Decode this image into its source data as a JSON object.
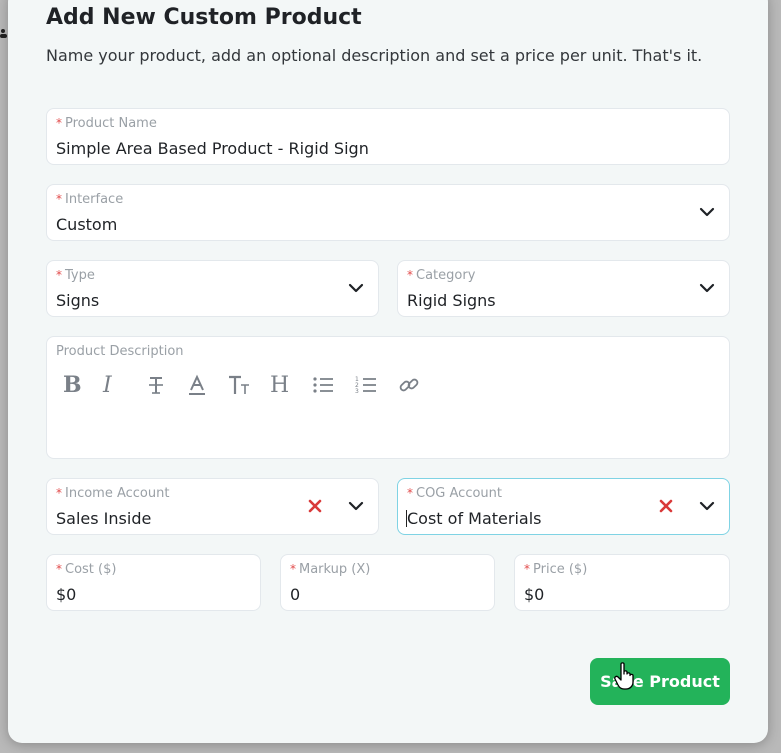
{
  "modal": {
    "title": "Add New Custom Product",
    "subtitle": "Name your product, add an optional description and set a price per unit. That's it."
  },
  "fields": {
    "product_name": {
      "label": "Product Name",
      "value": "Simple Area Based Product - Rigid Sign",
      "required_mark": "*"
    },
    "interface": {
      "label": "Interface",
      "value": "Custom",
      "required_mark": "*"
    },
    "type": {
      "label": "Type",
      "value": "Signs",
      "required_mark": "*"
    },
    "category": {
      "label": "Category",
      "value": "Rigid Signs",
      "required_mark": "*"
    },
    "description": {
      "label": "Product Description"
    },
    "income_account": {
      "label": "Income Account",
      "value": "Sales Inside",
      "required_mark": "*"
    },
    "cog_account": {
      "label": "COG Account",
      "value": "Cost of Materials",
      "required_mark": "*"
    },
    "cost": {
      "label": "Cost ($)",
      "value": "$0",
      "required_mark": "*"
    },
    "markup": {
      "label": "Markup (X)",
      "value": "0",
      "required_mark": "*"
    },
    "price": {
      "label": "Price ($)",
      "value": "$0",
      "required_mark": "*"
    }
  },
  "toolbar": {
    "bold": "B",
    "italic": "I",
    "heading": "H"
  },
  "actions": {
    "save_label": "Save Product"
  },
  "colors": {
    "accent": "#23b35a",
    "required": "#e24b4b",
    "clear": "#d93a3a",
    "focus": "#7fd3e4"
  },
  "icons": [
    "chevron-down-icon",
    "clear-x-icon",
    "bold-icon",
    "italic-icon",
    "strikethrough-icon",
    "text-color-icon",
    "text-size-icon",
    "heading-icon",
    "bullet-list-icon",
    "numbered-list-icon",
    "link-icon",
    "hand-cursor-icon"
  ]
}
